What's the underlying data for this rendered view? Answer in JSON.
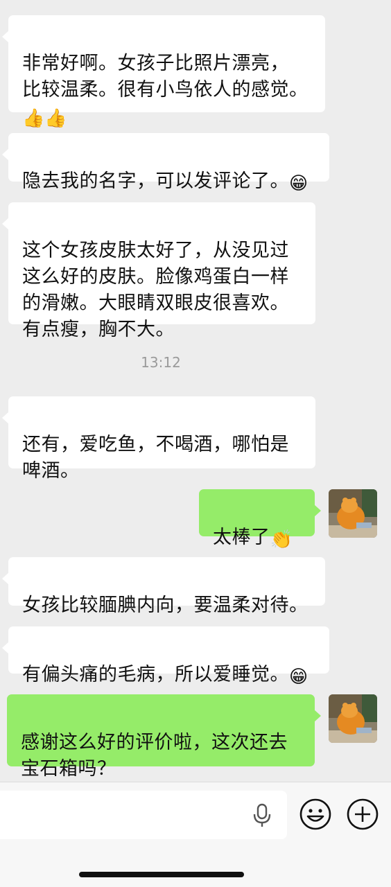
{
  "messages": [
    {
      "text": "非常好啊。女孩子比照片漂亮，\n比较温柔。很有小鸟依人的感觉。\n",
      "emoji": "👍👍"
    },
    {
      "text": "隐去我的名字，可以发评论了。",
      "emoji": "😁"
    },
    {
      "text": "这个女孩皮肤太好了，从没见过\n这么好的皮肤。脸像鸡蛋白一样\n的滑嫩。大眼睛双眼皮很喜欢。\n有点瘦，胸不大。"
    },
    {
      "text": "还有，爱吃鱼，不喝酒，哪怕是\n啤酒。"
    },
    {
      "text": "太棒了",
      "emoji": "👏"
    },
    {
      "text": "女孩比较腼腆内向，要温柔对待。"
    },
    {
      "text": "有偏头痛的毛病，所以爱睡觉。",
      "emoji": "😁"
    },
    {
      "text": "感谢这么好的评价啦，这次还去\n宝石箱吗？"
    }
  ],
  "timestamp": "13:12",
  "input": {
    "placeholder": ""
  },
  "icons": {
    "voice": "microphone-icon",
    "emoji_button": "smiley-icon",
    "more_button": "plus-circle-icon"
  },
  "colors": {
    "background": "#ededed",
    "incoming_bubble": "#ffffff",
    "outgoing_bubble": "#95ec69"
  }
}
